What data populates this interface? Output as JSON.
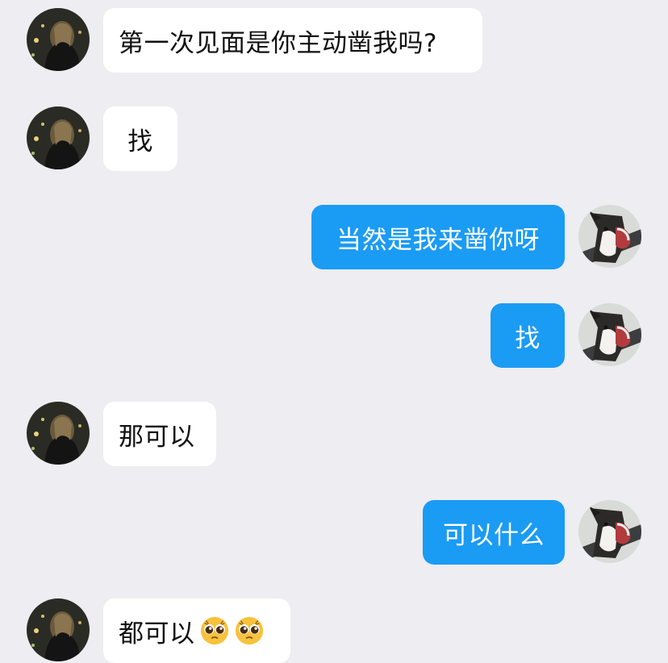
{
  "chat": {
    "messages": [
      {
        "sender": "her",
        "text": "第一次见面是你主动凿我吗?"
      },
      {
        "sender": "her",
        "text": "找"
      },
      {
        "sender": "me",
        "text": "当然是我来凿你呀"
      },
      {
        "sender": "me",
        "text": "找"
      },
      {
        "sender": "her",
        "text": "那可以"
      },
      {
        "sender": "me",
        "text": "可以什么"
      },
      {
        "sender": "her",
        "text": "都可以",
        "emojis": [
          "pleading-face-emoji",
          "pleading-face-emoji"
        ]
      }
    ]
  },
  "avatars": {
    "her": "woman-night-photo-avatar",
    "me": "husky-dog-avatar"
  },
  "colors": {
    "background": "#ededf2",
    "my_bubble": "#1a9bf4",
    "their_bubble": "#ffffff"
  }
}
